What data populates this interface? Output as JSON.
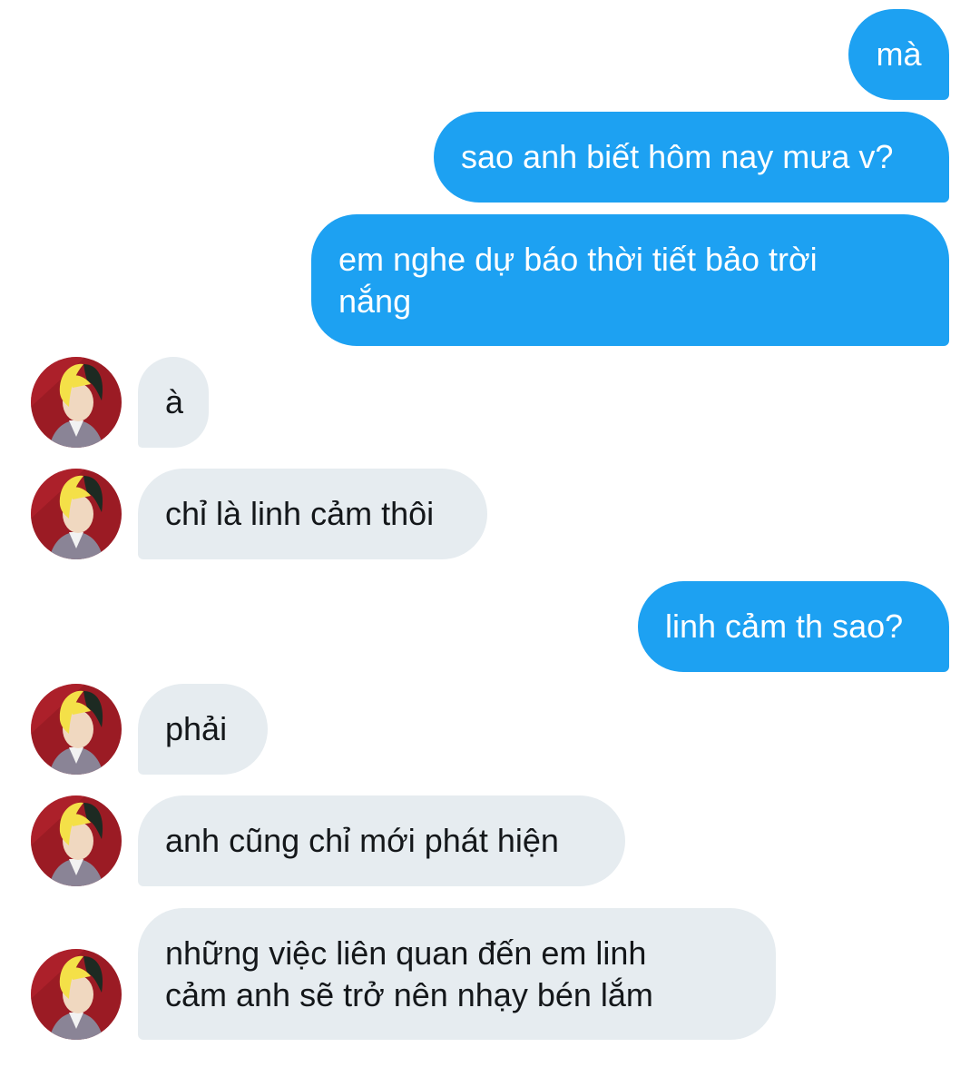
{
  "colors": {
    "outgoing_bubble": "#1da1f2",
    "incoming_bubble": "#e6ecf0",
    "background": "#ffffff"
  },
  "messages": [
    {
      "side": "out",
      "text": "mà"
    },
    {
      "side": "out",
      "text": "sao anh biết hôm nay mưa v?"
    },
    {
      "side": "out",
      "text": "em nghe dự báo thời tiết bảo trời\nnắng"
    },
    {
      "side": "in",
      "text": "à",
      "avatar": "anime-character-avatar"
    },
    {
      "side": "in",
      "text": "chỉ là linh cảm thôi",
      "avatar": "anime-character-avatar"
    },
    {
      "side": "out",
      "text": "linh cảm th sao?"
    },
    {
      "side": "in",
      "text": "phải",
      "avatar": "anime-character-avatar"
    },
    {
      "side": "in",
      "text": "anh cũng chỉ mới phát hiện",
      "avatar": "anime-character-avatar"
    },
    {
      "side": "in",
      "text": "những việc liên quan đến em linh\ncảm anh sẽ trở nên nhạy bén lắm",
      "avatar": "anime-character-avatar"
    }
  ]
}
